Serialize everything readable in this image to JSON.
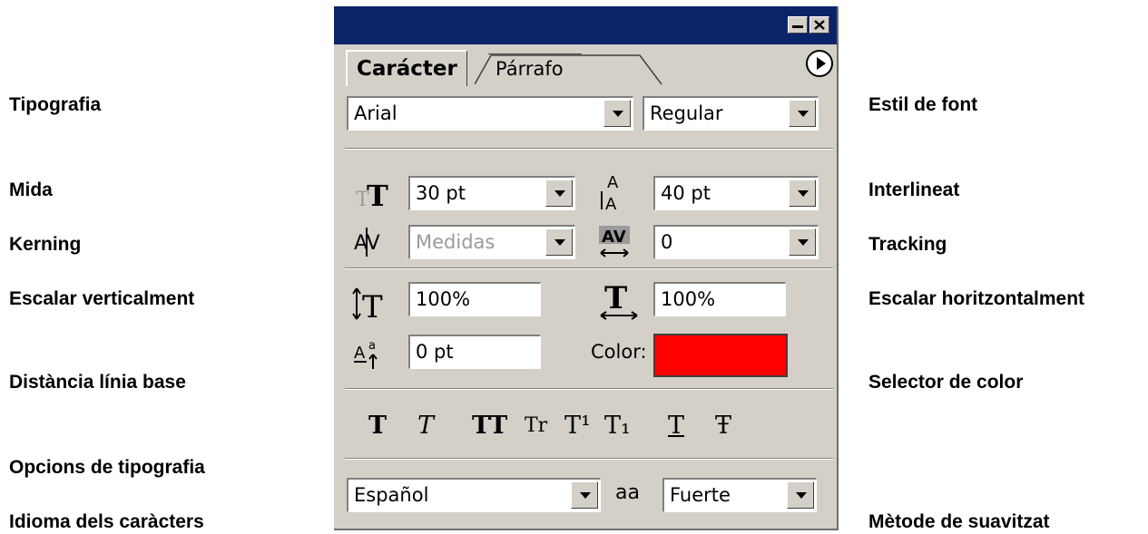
{
  "labels": {
    "tipografia": "Tipografia",
    "mida": "Mida",
    "kerning": "Kerning",
    "escalar_vert": "Escalar verticalment",
    "distancia": "Distància línia base",
    "opcions": "Opcions de tipografia",
    "idioma": "Idioma dels caràcters",
    "estil": "Estil de font",
    "interlineat": "Interlineat",
    "tracking": "Tracking",
    "escalar_horiz": "Escalar horitzontalment",
    "selector": "Selector de color",
    "suavitzat": "Mètode de suavitzat"
  },
  "panel": {
    "tabs": {
      "active": "Carácter",
      "inactive": "Párrafo"
    },
    "font_family": "Arial",
    "font_style": "Regular",
    "size": "30 pt",
    "leading": "40 pt",
    "kerning": "Medidas",
    "tracking": "0",
    "vertical_scale": "100%",
    "horizontal_scale": "100%",
    "baseline_shift": "0 pt",
    "color_label": "Color:",
    "color_value": "#ff0000",
    "style_buttons": [
      "T",
      "T",
      "TT",
      "Tr",
      "T¹",
      "T₁",
      "T",
      "Ŧ"
    ],
    "language": "Español",
    "antialias_icon": "aa",
    "antialias": "Fuerte"
  }
}
